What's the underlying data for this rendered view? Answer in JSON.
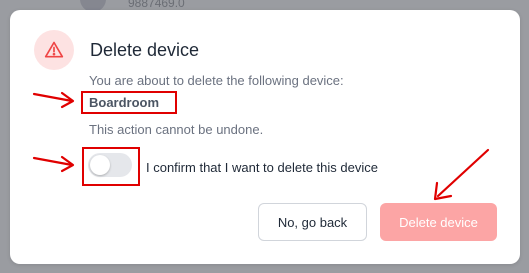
{
  "background": {
    "partial_text": "9887469.0"
  },
  "dialog": {
    "title": "Delete device",
    "description": "You are about to delete the following device:",
    "device_name": "Boardroom",
    "warning": "This action cannot be undone.",
    "confirm_label": "I confirm that I want to delete this device",
    "confirm_checked": false,
    "cancel_label": "No, go back",
    "delete_label": "Delete device",
    "delete_enabled": false
  },
  "colors": {
    "danger": "#ef4444",
    "danger_light": "#fca5a5",
    "annotation": "#e00000"
  }
}
